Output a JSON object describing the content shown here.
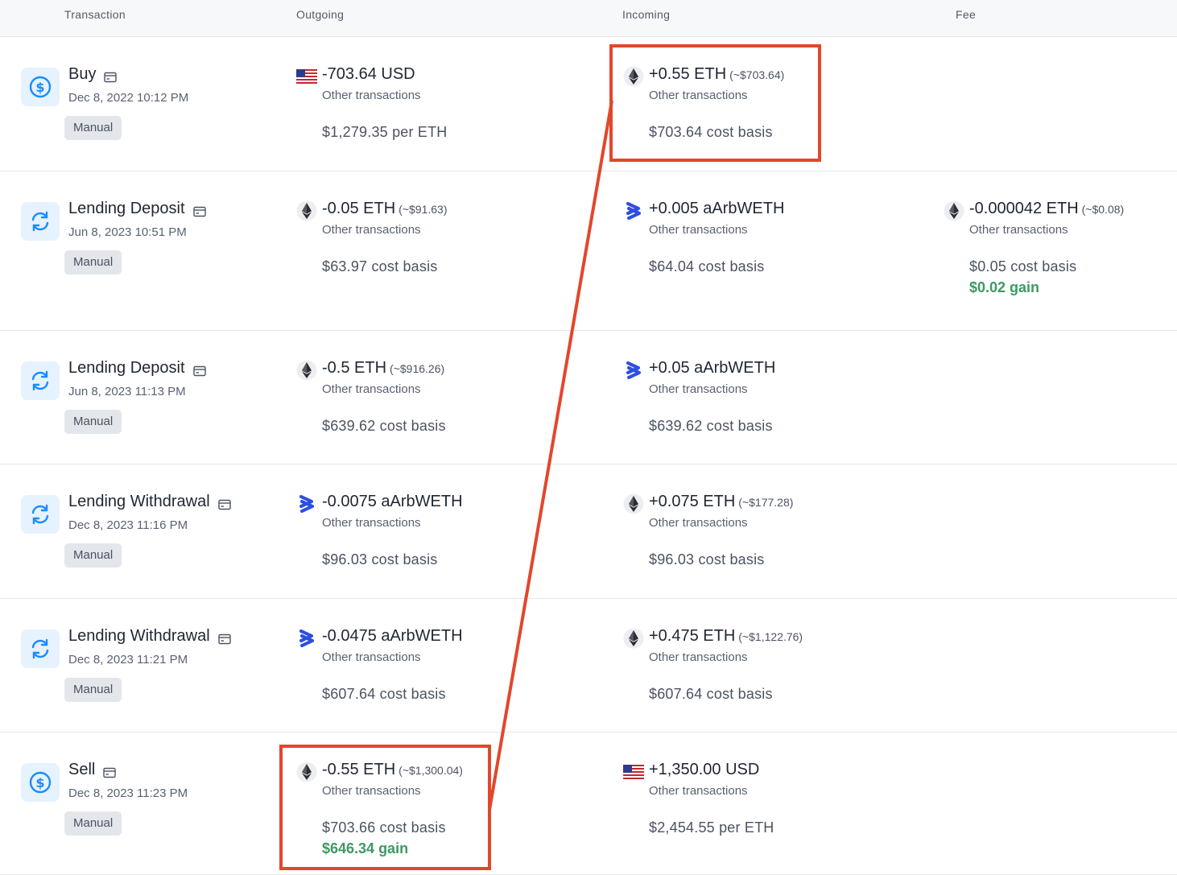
{
  "header": {
    "transaction": "Transaction",
    "outgoing": "Outgoing",
    "incoming": "Incoming",
    "fee": "Fee"
  },
  "colors": {
    "accent_blue": "#1a8cff",
    "gain_green": "#3d9a63",
    "highlight_red": "#e2472c",
    "aave_blue": "#2d4fe0"
  },
  "rows": [
    {
      "icon": "dollar-icon",
      "title": "Buy",
      "date": "Dec 8, 2022 10:12 PM",
      "badge": "Manual",
      "outgoing": {
        "asset_icon": "us-flag-icon",
        "amount": "-703.64 USD",
        "approx": "",
        "sub": "Other transactions",
        "basis": "$1,279.35 per ETH",
        "gain": ""
      },
      "incoming": {
        "asset_icon": "eth-icon",
        "amount": "+0.55 ETH",
        "approx": "(~$703.64)",
        "sub": "Other transactions",
        "basis": "$703.64 cost basis",
        "gain": ""
      },
      "fee": null
    },
    {
      "icon": "swap-icon",
      "title": "Lending Deposit",
      "date": "Jun 8, 2023 10:51 PM",
      "badge": "Manual",
      "outgoing": {
        "asset_icon": "eth-icon",
        "amount": "-0.05 ETH",
        "approx": "(~$91.63)",
        "sub": "Other transactions",
        "basis": "$63.97 cost basis",
        "gain": ""
      },
      "incoming": {
        "asset_icon": "aave-icon",
        "amount": "+0.005 aArbWETH",
        "approx": "",
        "sub": "Other transactions",
        "basis": "$64.04 cost basis",
        "gain": ""
      },
      "fee": {
        "asset_icon": "eth-icon",
        "amount": "-0.000042 ETH",
        "approx": "(~$0.08)",
        "sub": "Other transactions",
        "basis": "$0.05 cost basis",
        "gain": "$0.02 gain"
      }
    },
    {
      "icon": "swap-icon",
      "title": "Lending Deposit",
      "date": "Jun 8, 2023 11:13 PM",
      "badge": "Manual",
      "outgoing": {
        "asset_icon": "eth-icon",
        "amount": "-0.5 ETH",
        "approx": "(~$916.26)",
        "sub": "Other transactions",
        "basis": "$639.62 cost basis",
        "gain": ""
      },
      "incoming": {
        "asset_icon": "aave-icon",
        "amount": "+0.05 aArbWETH",
        "approx": "",
        "sub": "Other transactions",
        "basis": "$639.62 cost basis",
        "gain": ""
      },
      "fee": null
    },
    {
      "icon": "swap-icon",
      "title": "Lending Withdrawal",
      "date": "Dec 8, 2023 11:16 PM",
      "badge": "Manual",
      "outgoing": {
        "asset_icon": "aave-icon",
        "amount": "-0.0075 aArbWETH",
        "approx": "",
        "sub": "Other transactions",
        "basis": "$96.03 cost basis",
        "gain": ""
      },
      "incoming": {
        "asset_icon": "eth-icon",
        "amount": "+0.075 ETH",
        "approx": "(~$177.28)",
        "sub": "Other transactions",
        "basis": "$96.03 cost basis",
        "gain": ""
      },
      "fee": null
    },
    {
      "icon": "swap-icon",
      "title": "Lending Withdrawal",
      "date": "Dec 8, 2023 11:21 PM",
      "badge": "Manual",
      "outgoing": {
        "asset_icon": "aave-icon",
        "amount": "-0.0475 aArbWETH",
        "approx": "",
        "sub": "Other transactions",
        "basis": "$607.64 cost basis",
        "gain": ""
      },
      "incoming": {
        "asset_icon": "eth-icon",
        "amount": "+0.475 ETH",
        "approx": "(~$1,122.76)",
        "sub": "Other transactions",
        "basis": "$607.64 cost basis",
        "gain": ""
      },
      "fee": null
    },
    {
      "icon": "dollar-icon",
      "title": "Sell",
      "date": "Dec 8, 2023 11:23 PM",
      "badge": "Manual",
      "outgoing": {
        "asset_icon": "eth-icon",
        "amount": "-0.55 ETH",
        "approx": "(~$1,300.04)",
        "sub": "Other transactions",
        "basis": "$703.66 cost basis",
        "gain": "$646.34 gain"
      },
      "incoming": {
        "asset_icon": "us-flag-icon",
        "amount": "+1,350.00 USD",
        "approx": "",
        "sub": "Other transactions",
        "basis": "$2,454.55 per ETH",
        "gain": ""
      },
      "fee": null
    }
  ]
}
